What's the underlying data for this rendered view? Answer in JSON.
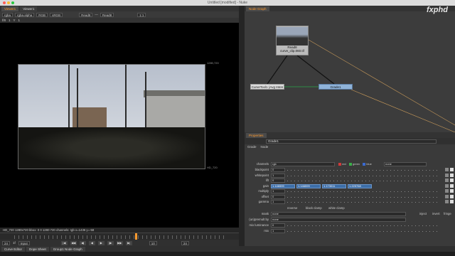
{
  "window": {
    "title": "Untitled [modified] - Nuke"
  },
  "viewer": {
    "tabs": [
      "Viewer1",
      "Viewer1"
    ],
    "layer": "rgba",
    "channel": "rgba.alpha",
    "colorspace": "RGB",
    "lut": "sRGB",
    "input_a": "Read8",
    "input_b": "Read8",
    "zoom": "1:1",
    "toolbar2": [
      "f/8",
      "1",
      "Y",
      "1"
    ],
    "corner_tl": "",
    "corner_tr": "1280,720",
    "corner_br": "HD_720",
    "info": "HD_720 1280x720  bbox: 0 0 1280 720 channels: rgb   x=1436 y=-58",
    "frame": "24",
    "fps": "1f",
    "input_mode": "Input",
    "transport": [
      "|◀",
      "◀◀",
      "◀|",
      "◀",
      "▶",
      "|▶",
      "▶▶",
      "▶|"
    ],
    "step": "10",
    "end_frame": "24"
  },
  "bottom_tabs": [
    "Curve Editor",
    "Dope Sheet",
    "Group1 Node Graph"
  ],
  "node_graph": {
    "tab": "Node Graph",
    "watermark": "fxphd",
    "read_node": {
      "label": "Read8",
      "file": "curve_clip.060.tif"
    },
    "curvetool_node": {
      "label": "CurveTool1 (Avg Inten"
    },
    "grade_node": {
      "label": "Grade1"
    }
  },
  "properties": {
    "tab": "Properties",
    "node_name": "Grade1",
    "subtabs": [
      "Grade",
      "Node"
    ],
    "channels_label": "channels",
    "channels_value": "rgb",
    "channel_chips": [
      {
        "name": "red",
        "color": "#d03a3a"
      },
      {
        "name": "green",
        "color": "#3ab04a"
      },
      {
        "name": "blue",
        "color": "#3a6ad0"
      }
    ],
    "channels_extra": "none",
    "rows": [
      {
        "label": "blackpoint",
        "value": "0"
      },
      {
        "label": "whitepoint",
        "value": "1"
      },
      {
        "label": "lift",
        "value": "0"
      },
      {
        "label": "gain",
        "values": [
          "1.146599",
          "1.146599",
          "1.173011",
          "1.225768"
        ]
      },
      {
        "label": "multiply",
        "value": "1"
      },
      {
        "label": "offset",
        "value": "0"
      },
      {
        "label": "gamma",
        "value": "1"
      }
    ],
    "clamps": [
      "reverse",
      "black clamp",
      "white clamp"
    ],
    "mask_label": "mask",
    "mask_value": "none",
    "mask_opts": [
      "inject",
      "invert",
      "fringe"
    ],
    "premult_label": "(un)premult by",
    "premult_value": "none",
    "lum_label": "mix luminance",
    "lum_value": "0",
    "mix_label": "mix",
    "mix_value": "1"
  }
}
